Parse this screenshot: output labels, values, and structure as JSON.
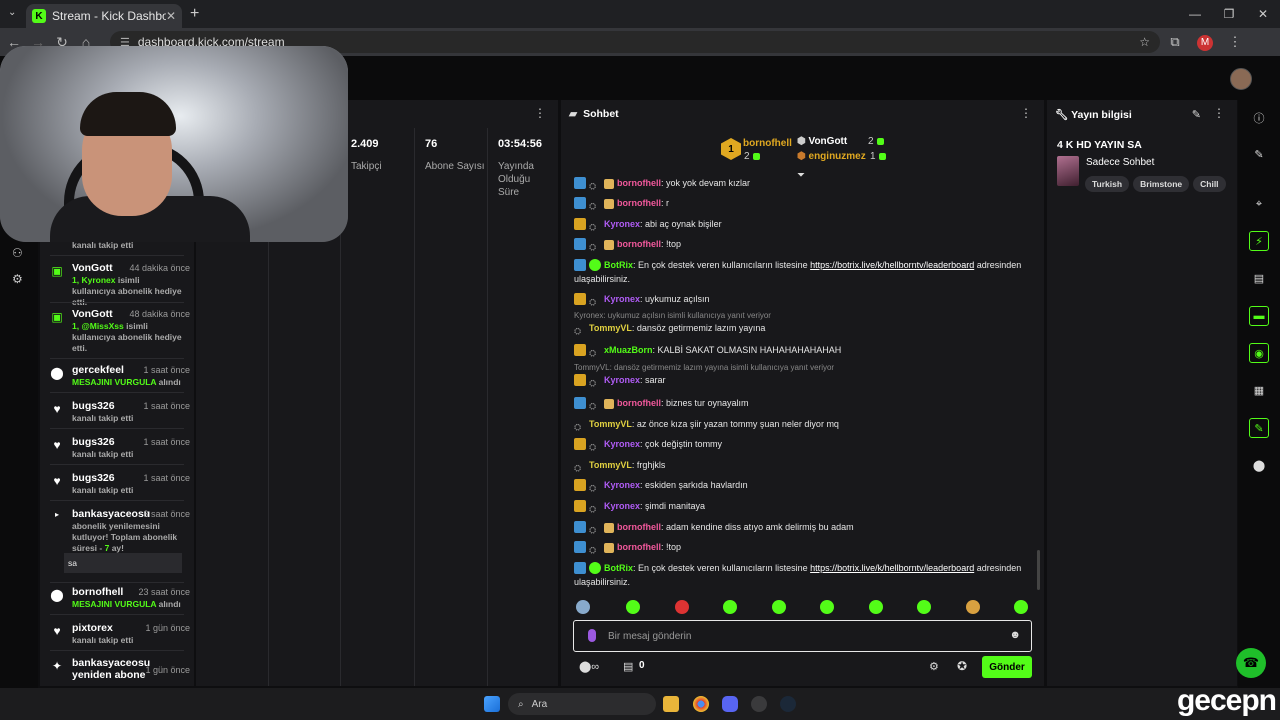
{
  "browser": {
    "tab_title": "Stream - Kick Dashboard",
    "tab_icon": "K",
    "url": "dashboard.kick.com/stream",
    "profile_initial": "M"
  },
  "activity": {
    "items": [
      {
        "sub": "kanalı takip etti"
      },
      {
        "name": "VonGott",
        "time": "44 dakika önce",
        "hl": "1, Kyronex",
        "sub": " isimli kullanıcıya abonelik hediye etti."
      },
      {
        "name": "VonGott",
        "time": "48 dakika önce",
        "hl": "1, @MissXss",
        "sub": " isimli kullanıcıya abonelik hediye etti."
      },
      {
        "name": "gercekfeel",
        "time": "1 saat önce",
        "hl": "MESAJINI VURGULA",
        "sub": " alındı"
      },
      {
        "name": "bugs326",
        "time": "1 saat önce",
        "sub": "kanalı takip etti"
      },
      {
        "name": "bugs326",
        "time": "1 saat önce",
        "sub": "kanalı takip etti"
      },
      {
        "name": "bugs326",
        "time": "1 saat önce",
        "sub": "kanalı takip etti"
      },
      {
        "name": "bankasyaceosu",
        "time": "3 saat önce",
        "sub": "abonelik yenilemesini kutluyor! Toplam abonelik süresi - ",
        "hl": "7",
        "sub2": " ay!",
        "reply": "sa"
      },
      {
        "name": "bornofhell",
        "time": "23 saat önce",
        "hl": "MESAJINI VURGULA",
        "sub": " alındı"
      },
      {
        "name": "pixtorex",
        "time": "1 gün önce",
        "sub": "kanalı takip etti"
      },
      {
        "name": "bankasyaceosu",
        "name2": "yeniden abone",
        "time": "1 gün önce"
      }
    ]
  },
  "stats": [
    {
      "value": "2.409",
      "label": "Takipçi"
    },
    {
      "value": "76",
      "label": "Abone Sayısı"
    },
    {
      "value": "03:54:56",
      "label": "Yayında Olduğu Süre"
    }
  ],
  "chat": {
    "title": "Sohbet",
    "top": [
      {
        "rank": "1",
        "name": "bornofhell",
        "count": "2"
      },
      {
        "name": "VonGott",
        "count": "2"
      },
      {
        "name": "enginuzmez",
        "count": "1"
      }
    ],
    "messages": [
      {
        "badges": [
          "ver",
          "ninja",
          "gift"
        ],
        "user": "bornofhell",
        "color": "#f0589b",
        "text": "yok yok devam kızlar"
      },
      {
        "badges": [
          "ver",
          "ninja",
          "gift"
        ],
        "user": "bornofhell",
        "color": "#f0589b",
        "text": "r"
      },
      {
        "badges": [
          "crown",
          "ninja"
        ],
        "user": "Kyronex",
        "color": "#b05cf5",
        "text": "abi aç oynak bişiler"
      },
      {
        "badges": [
          "ver",
          "ninja",
          "gift"
        ],
        "user": "bornofhell",
        "color": "#f0589b",
        "text": "!top"
      },
      {
        "badges": [
          "ver",
          "bot"
        ],
        "user": "BotRix",
        "color": "#53fc18",
        "text": "En çok destek veren kullanıcıların listesine ",
        "link": "https://botrix.live/k/hellborntv/leaderboard",
        "after": " adresinden ulaşabilirsiniz."
      },
      {
        "badges": [
          "crown",
          "ninja"
        ],
        "user": "Kyronex",
        "color": "#b05cf5",
        "text": "uykumuz açılsın"
      },
      {
        "reply": "Kyronex: uykumuz açılsın isimli kullanıcıya yanıt veriyor",
        "badges": [
          "ninja"
        ],
        "user": "TommyVL",
        "color": "#e0d040",
        "text": "dansöz getirmemiz lazım yayına"
      },
      {
        "badges": [
          "crown",
          "ninja"
        ],
        "user": "xMuazBorn",
        "color": "#53fc18",
        "text": "KALBİ SAKAT OLMASIN HAHAHAHAHAHAH"
      },
      {
        "reply": "TommyVL: dansöz getirmemiz lazım yayına isimli kullanıcıya yanıt veriyor",
        "badges": [
          "crown",
          "ninja"
        ],
        "user": "Kyronex",
        "color": "#b05cf5",
        "text": "sarar"
      },
      {
        "badges": [
          "ver",
          "ninja",
          "gift"
        ],
        "user": "bornofhell",
        "color": "#f0589b",
        "text": "biznes tur oynayalım"
      },
      {
        "badges": [
          "ninja"
        ],
        "user": "TommyVL",
        "color": "#e0d040",
        "text": "az önce kıza şiir yazan tommy şuan neler diyor mq"
      },
      {
        "badges": [
          "crown",
          "ninja"
        ],
        "user": "Kyronex",
        "color": "#b05cf5",
        "text": "çok değiştin tommy"
      },
      {
        "badges": [
          "ninja"
        ],
        "user": "TommyVL",
        "color": "#e0d040",
        "text": "frghjkls"
      },
      {
        "badges": [
          "crown",
          "ninja"
        ],
        "user": "Kyronex",
        "color": "#b05cf5",
        "text": "eskiden şarkıda havlardın"
      },
      {
        "badges": [
          "crown",
          "ninja"
        ],
        "user": "Kyronex",
        "color": "#b05cf5",
        "text": "şimdi manitaya"
      },
      {
        "badges": [
          "ver",
          "ninja",
          "gift"
        ],
        "user": "bornofhell",
        "color": "#f0589b",
        "text": "adam kendine diss atıyo amk delirmiş bu adam"
      },
      {
        "badges": [
          "ver",
          "ninja",
          "gift"
        ],
        "user": "bornofhell",
        "color": "#f0589b",
        "text": "!top"
      },
      {
        "badges": [
          "ver",
          "bot"
        ],
        "user": "BotRix",
        "color": "#53fc18",
        "text": "En çok destek veren kullanıcıların listesine ",
        "link": "https://botrix.live/k/hellborntv/leaderboard",
        "after": " adresinden ulaşabilirsiniz."
      }
    ],
    "placeholder": "Bir mesaj gönderin",
    "points": "0",
    "send_label": "Gönder"
  },
  "info": {
    "title": "Yayın bilgisi",
    "stream_title": "4 K HD YAYIN SA",
    "category": "Sadece Sohbet",
    "tags": [
      "Turkish",
      "Brimstone",
      "Chill"
    ]
  },
  "taskbar": {
    "search_label": "Ara"
  },
  "watermark": "gecepn"
}
